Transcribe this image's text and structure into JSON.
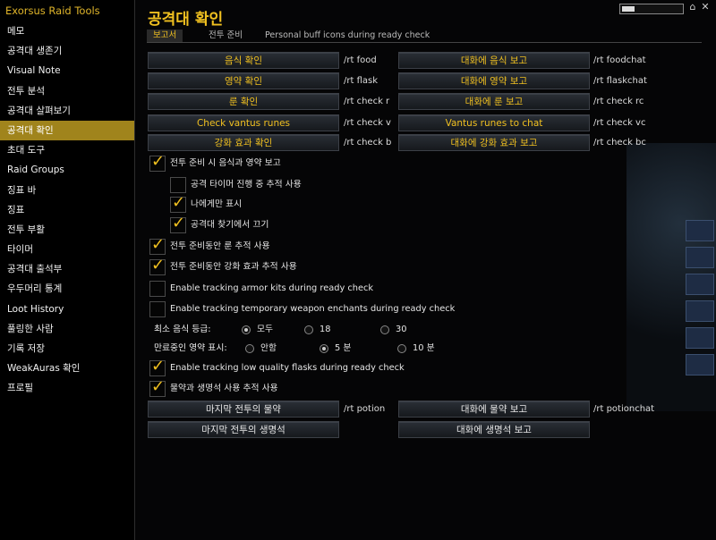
{
  "app_title": "Exorsus Raid Tools",
  "page_title": "공격대 확인",
  "sidebar": {
    "items": [
      {
        "label": "메모",
        "active": false
      },
      {
        "label": "공격대 생존기",
        "active": false
      },
      {
        "label": "Visual Note",
        "active": false
      },
      {
        "label": "전투 분석",
        "active": false
      },
      {
        "label": "공격대 살펴보기",
        "active": false
      },
      {
        "label": "공격대 확인",
        "active": true
      },
      {
        "label": "초대 도구",
        "active": false
      },
      {
        "label": "Raid Groups",
        "active": false
      },
      {
        "label": "징표 바",
        "active": false
      },
      {
        "label": "징표",
        "active": false
      },
      {
        "label": "전투 부활",
        "active": false
      },
      {
        "label": "타이머",
        "active": false
      },
      {
        "label": "공격대 출석부",
        "active": false
      },
      {
        "label": "우두머리 통계",
        "active": false
      },
      {
        "label": "Loot History",
        "active": false
      },
      {
        "label": "풀링한 사람",
        "active": false
      },
      {
        "label": "기록 저장",
        "active": false
      },
      {
        "label": "WeakAuras 확인",
        "active": false
      },
      {
        "label": "프로필",
        "active": false
      }
    ]
  },
  "tabs": [
    "보고서",
    "전투 준비",
    "Personal buff icons during ready check"
  ],
  "buttons": [
    {
      "left": "음식 확인",
      "left_cmd": "/rt food",
      "right": "대화에 음식 보고",
      "right_cmd": "/rt foodchat"
    },
    {
      "left": "영약 확인",
      "left_cmd": "/rt flask",
      "right": "대화에 영약 보고",
      "right_cmd": "/rt flaskchat"
    },
    {
      "left": "룬 확인",
      "left_cmd": "/rt check r",
      "right": "대화에 룬 보고",
      "right_cmd": "/rt check rc"
    },
    {
      "left": "Check vantus runes",
      "left_cmd": "/rt check v",
      "right": "Vantus runes to chat",
      "right_cmd": "/rt check vc"
    },
    {
      "left": "강화 효과 확인",
      "left_cmd": "/rt check b",
      "right": "대화에 강화 효과 보고",
      "right_cmd": "/rt check bc"
    }
  ],
  "checkboxes": {
    "ready_food_flask": {
      "label": "전투 준비 시 음식과 영약 보고",
      "checked": true
    },
    "track_timer": {
      "label": "공격 타이머 진행 중 추적 사용",
      "checked": false
    },
    "only_me": {
      "label": "나에게만 표시",
      "checked": true
    },
    "disable_lfr": {
      "label": "공격대 찾기에서 끄기",
      "checked": true
    },
    "track_runes": {
      "label": "전투 준비동안 룬 추적 사용",
      "checked": true
    },
    "track_buffs": {
      "label": "전투 준비동안 강화 효과 추적 사용",
      "checked": true
    },
    "armor_kits": {
      "label": "Enable tracking armor kits during ready check",
      "checked": false
    },
    "weapon_enchants": {
      "label": "Enable tracking temporary weapon enchants during ready check",
      "checked": false
    },
    "low_flasks": {
      "label": "Enable tracking low quality flasks during ready check",
      "checked": true
    },
    "potions": {
      "label": "물약과 생명석 사용 추적 사용",
      "checked": true
    }
  },
  "food_level": {
    "label": "최소 음식 등급:",
    "options": [
      "모두",
      "18",
      "30"
    ],
    "selected": "모두"
  },
  "flask_expire": {
    "label": "만료중인 영약 표시:",
    "options": [
      "안함",
      "5 분",
      "10 분"
    ],
    "selected": "5 분"
  },
  "bottom_buttons": [
    {
      "left": "마지막 전투의 물약",
      "left_cmd": "/rt potion",
      "right": "대화에 물약 보고",
      "right_cmd": "/rt potionchat"
    },
    {
      "left": "마지막 전투의 생명석",
      "left_cmd": "",
      "right": "대화에 생명석 보고",
      "right_cmd": ""
    }
  ],
  "colors": {
    "accent": "#f0c020",
    "active_sidebar": "#a0841c"
  }
}
